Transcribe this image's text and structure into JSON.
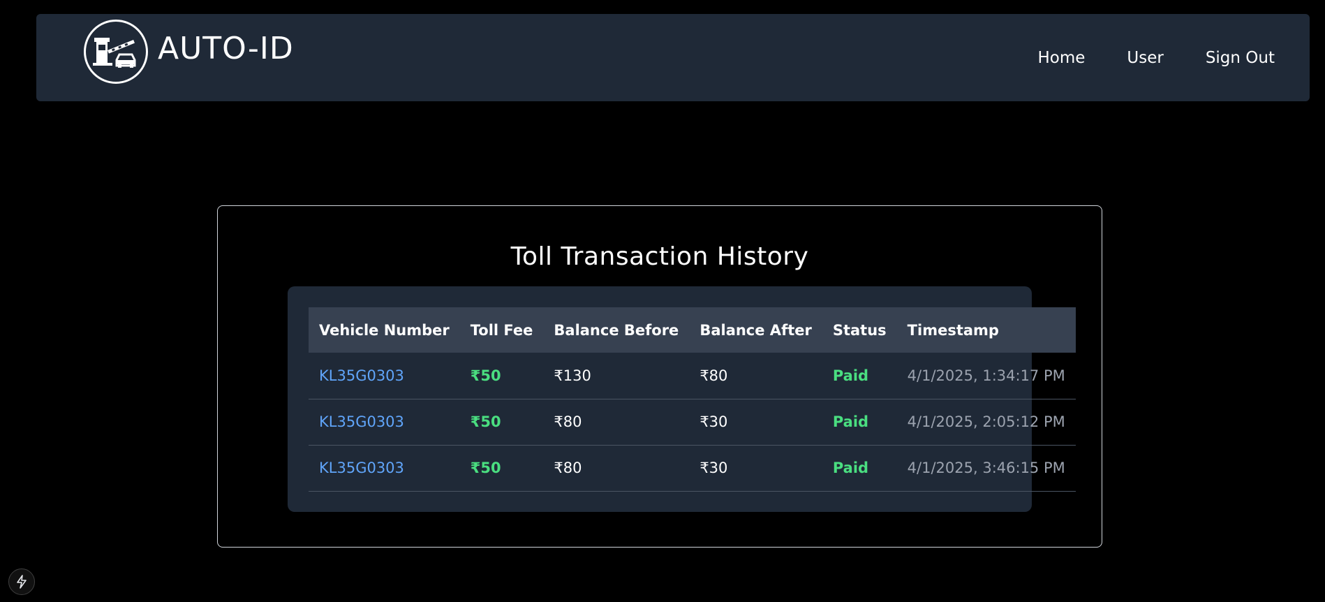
{
  "navbar": {
    "brand": "AUTO-ID",
    "logo_icon": "toll-gate-car-icon",
    "links": [
      "Home",
      "User",
      "Sign Out"
    ]
  },
  "card": {
    "title": "Toll Transaction History"
  },
  "table": {
    "headers": [
      "Vehicle Number",
      "Toll Fee",
      "Balance Before",
      "Balance After",
      "Status",
      "Timestamp"
    ],
    "rows": [
      {
        "vehicle": "KL35G0303",
        "fee": "₹50",
        "before": "₹130",
        "after": "₹80",
        "status": "Paid",
        "timestamp": "4/1/2025, 1:34:17 PM"
      },
      {
        "vehicle": "KL35G0303",
        "fee": "₹50",
        "before": "₹80",
        "after": "₹30",
        "status": "Paid",
        "timestamp": "4/1/2025, 2:05:12 PM"
      },
      {
        "vehicle": "KL35G0303",
        "fee": "₹50",
        "before": "₹80",
        "after": "₹30",
        "status": "Paid",
        "timestamp": "4/1/2025, 3:46:15 PM"
      }
    ]
  },
  "colors": {
    "panel": "#1f2937",
    "header_row": "#374151",
    "link": "#60a5fa",
    "success": "#4ade80",
    "muted": "#9ca3af"
  },
  "corner_button_icon": "lightning-bolt-icon"
}
